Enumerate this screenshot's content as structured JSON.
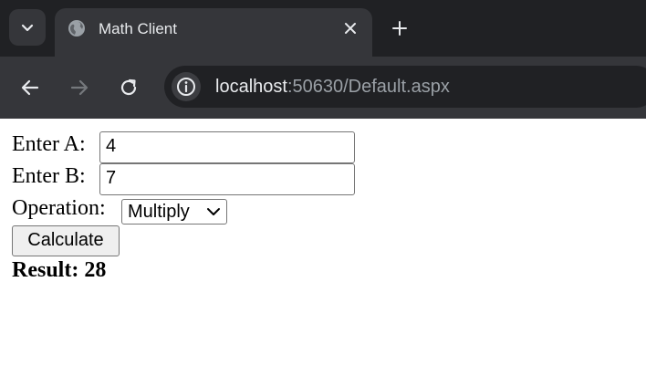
{
  "browser": {
    "tab": {
      "title": "Math Client",
      "favicon": "globe-icon"
    },
    "url": {
      "host": "localhost",
      "rest": ":50630/Default.aspx"
    },
    "icons": {
      "tab_search": "chevron-down-icon",
      "close_tab": "close-icon",
      "new_tab": "plus-icon",
      "back": "arrow-left-icon",
      "forward": "arrow-right-icon",
      "reload": "reload-icon",
      "site_info": "info-icon"
    },
    "colors": {
      "frame": "#202124",
      "toolbar": "#35363a",
      "text": "#e8eaed",
      "muted": "#9aa0a6"
    }
  },
  "form": {
    "a_label": "Enter A:",
    "a_value": "4",
    "b_label": "Enter B:",
    "b_value": "7",
    "operation_label": "Operation:",
    "operation_selected": "Multiply",
    "calculate_label": "Calculate",
    "result_text": "Result: 28"
  }
}
